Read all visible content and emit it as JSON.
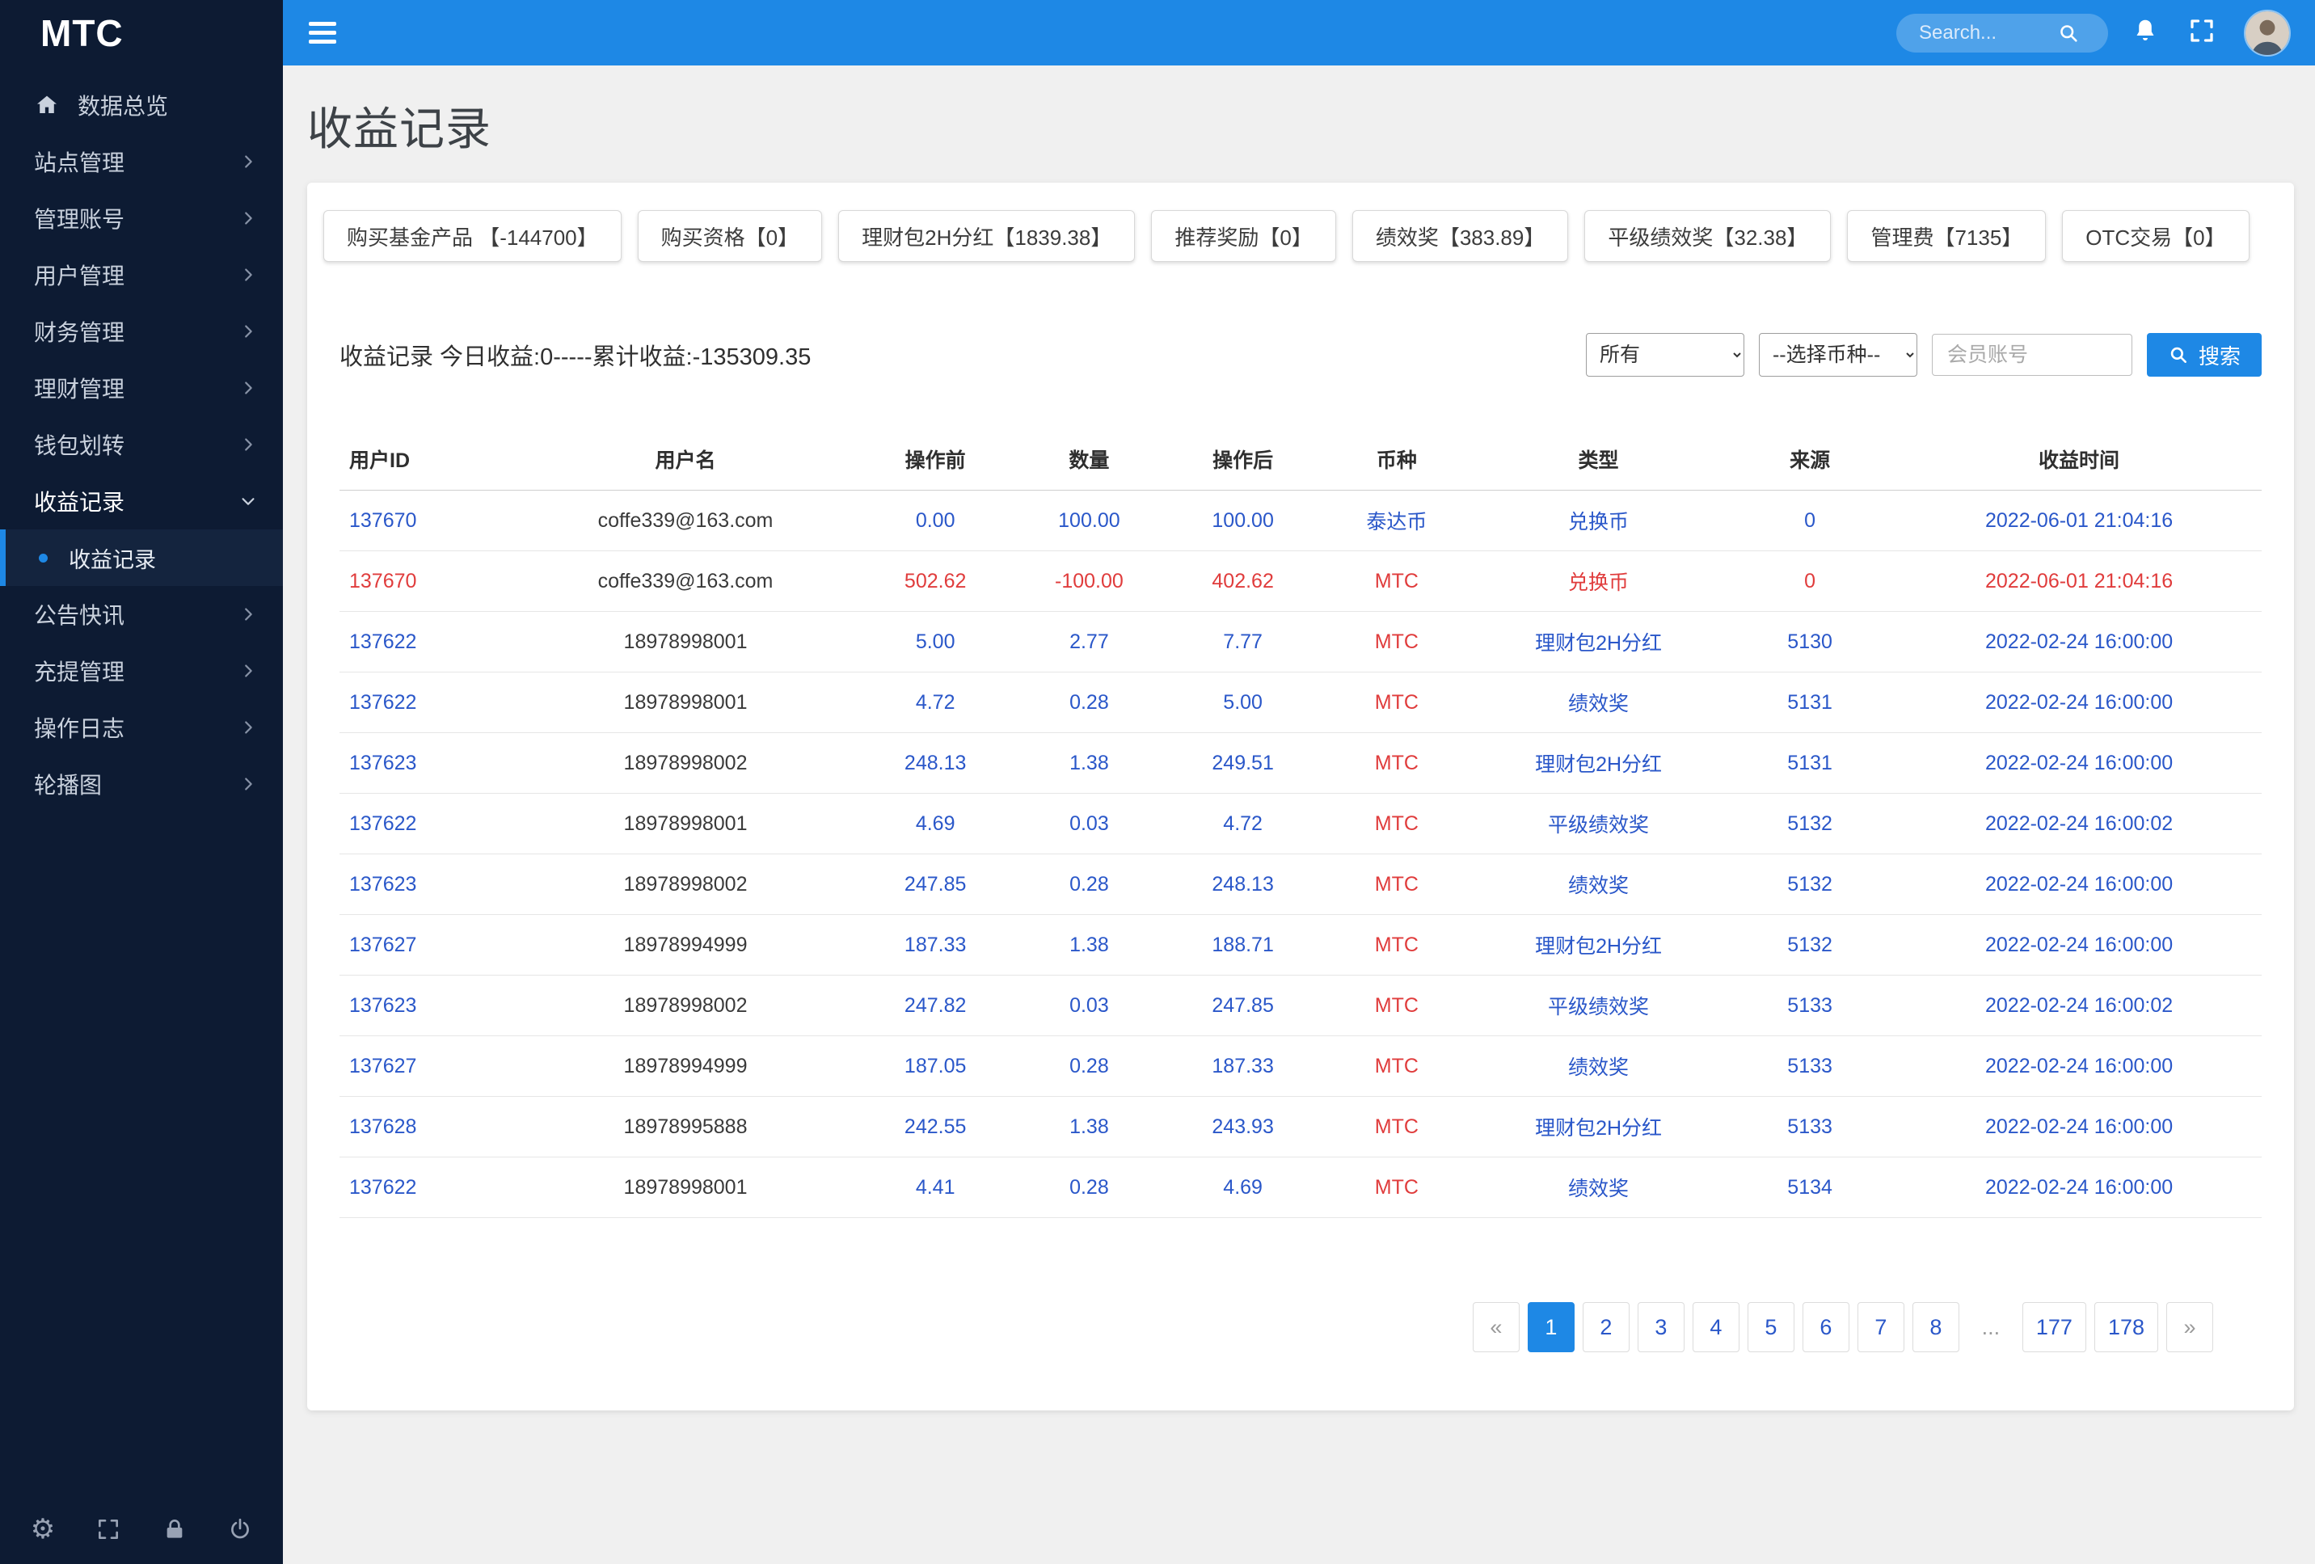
{
  "colors": {
    "topbar": "#1E88E5",
    "sidebar": "#0D1B33",
    "sidebar_sub": "#0A1526",
    "link_blue": "#2A57C9",
    "danger_red": "#E03C3C",
    "page_bg": "#F0F0F0",
    "active_page_bg": "#1E88E5"
  },
  "app": {
    "brand": "MTC"
  },
  "topbar": {
    "search_placeholder": "Search..."
  },
  "sidebar": {
    "items": [
      {
        "label": "数据总览",
        "icon": "home-icon"
      },
      {
        "label": "站点管理",
        "chevron": "right"
      },
      {
        "label": "管理账号",
        "chevron": "right"
      },
      {
        "label": "用户管理",
        "chevron": "right"
      },
      {
        "label": "财务管理",
        "chevron": "right"
      },
      {
        "label": "理财管理",
        "chevron": "right"
      },
      {
        "label": "钱包划转",
        "chevron": "right"
      },
      {
        "label": "收益记录",
        "chevron": "down",
        "active": true,
        "submenu": [
          {
            "label": "收益记录",
            "active": true
          }
        ]
      },
      {
        "label": "公告快讯",
        "chevron": "right"
      },
      {
        "label": "充提管理",
        "chevron": "right"
      },
      {
        "label": "操作日志",
        "chevron": "right"
      },
      {
        "label": "轮播图",
        "chevron": "right"
      }
    ],
    "footer_icons": [
      "gear-icon",
      "fullscreen-icon",
      "lock-icon",
      "power-icon"
    ]
  },
  "page": {
    "title": "收益记录"
  },
  "stats": [
    "购买基金产品 【-144700】",
    "购买资格【0】",
    "理财包2H分红【1839.38】",
    "推荐奖励【0】",
    "绩效奖【383.89】",
    "平级绩效奖【32.38】",
    "管理费【7135】",
    "OTC交易【0】"
  ],
  "main": {
    "summary": "收益记录 今日收益:0-----累计收益:-135309.35"
  },
  "filters": {
    "type_value": "所有",
    "coin_value": "--选择币种--",
    "account_placeholder": "会员账号",
    "search_label": "搜索"
  },
  "table": {
    "headers": [
      "用户ID",
      "用户名",
      "操作前",
      "数量",
      "操作后",
      "币种",
      "类型",
      "来源",
      "收益时间"
    ],
    "rows": [
      {
        "id": "137670",
        "name": "coffe339@163.com",
        "before": "0.00",
        "amount": "100.00",
        "after": "100.00",
        "coin": "泰达币",
        "type": "兑换币",
        "source": "0",
        "time": "2022-06-01 21:04:16",
        "tone": "blue",
        "coin_tone": "blue"
      },
      {
        "id": "137670",
        "name": "coffe339@163.com",
        "before": "502.62",
        "amount": "-100.00",
        "after": "402.62",
        "coin": "MTC",
        "type": "兑换币",
        "source": "0",
        "time": "2022-06-01 21:04:16",
        "tone": "red",
        "coin_tone": "red"
      },
      {
        "id": "137622",
        "name": "18978998001",
        "before": "5.00",
        "amount": "2.77",
        "after": "7.77",
        "coin": "MTC",
        "type": "理财包2H分红",
        "source": "5130",
        "time": "2022-02-24 16:00:00",
        "tone": "blue",
        "coin_tone": "red"
      },
      {
        "id": "137622",
        "name": "18978998001",
        "before": "4.72",
        "amount": "0.28",
        "after": "5.00",
        "coin": "MTC",
        "type": "绩效奖",
        "source": "5131",
        "time": "2022-02-24 16:00:00",
        "tone": "blue",
        "coin_tone": "red"
      },
      {
        "id": "137623",
        "name": "18978998002",
        "before": "248.13",
        "amount": "1.38",
        "after": "249.51",
        "coin": "MTC",
        "type": "理财包2H分红",
        "source": "5131",
        "time": "2022-02-24 16:00:00",
        "tone": "blue",
        "coin_tone": "red"
      },
      {
        "id": "137622",
        "name": "18978998001",
        "before": "4.69",
        "amount": "0.03",
        "after": "4.72",
        "coin": "MTC",
        "type": "平级绩效奖",
        "source": "5132",
        "time": "2022-02-24 16:00:02",
        "tone": "blue",
        "coin_tone": "red"
      },
      {
        "id": "137623",
        "name": "18978998002",
        "before": "247.85",
        "amount": "0.28",
        "after": "248.13",
        "coin": "MTC",
        "type": "绩效奖",
        "source": "5132",
        "time": "2022-02-24 16:00:00",
        "tone": "blue",
        "coin_tone": "red"
      },
      {
        "id": "137627",
        "name": "18978994999",
        "before": "187.33",
        "amount": "1.38",
        "after": "188.71",
        "coin": "MTC",
        "type": "理财包2H分红",
        "source": "5132",
        "time": "2022-02-24 16:00:00",
        "tone": "blue",
        "coin_tone": "red"
      },
      {
        "id": "137623",
        "name": "18978998002",
        "before": "247.82",
        "amount": "0.03",
        "after": "247.85",
        "coin": "MTC",
        "type": "平级绩效奖",
        "source": "5133",
        "time": "2022-02-24 16:00:02",
        "tone": "blue",
        "coin_tone": "red"
      },
      {
        "id": "137627",
        "name": "18978994999",
        "before": "187.05",
        "amount": "0.28",
        "after": "187.33",
        "coin": "MTC",
        "type": "绩效奖",
        "source": "5133",
        "time": "2022-02-24 16:00:00",
        "tone": "blue",
        "coin_tone": "red"
      },
      {
        "id": "137628",
        "name": "18978995888",
        "before": "242.55",
        "amount": "1.38",
        "after": "243.93",
        "coin": "MTC",
        "type": "理财包2H分红",
        "source": "5133",
        "time": "2022-02-24 16:00:00",
        "tone": "blue",
        "coin_tone": "red"
      },
      {
        "id": "137622",
        "name": "18978998001",
        "before": "4.41",
        "amount": "0.28",
        "after": "4.69",
        "coin": "MTC",
        "type": "绩效奖",
        "source": "5134",
        "time": "2022-02-24 16:00:00",
        "tone": "blue",
        "coin_tone": "red"
      }
    ]
  },
  "pagination": {
    "items": [
      "«",
      "1",
      "2",
      "3",
      "4",
      "5",
      "6",
      "7",
      "8",
      "...",
      "177",
      "178",
      "»"
    ],
    "active": "1",
    "disabled": [
      "«",
      "»",
      "..."
    ]
  }
}
